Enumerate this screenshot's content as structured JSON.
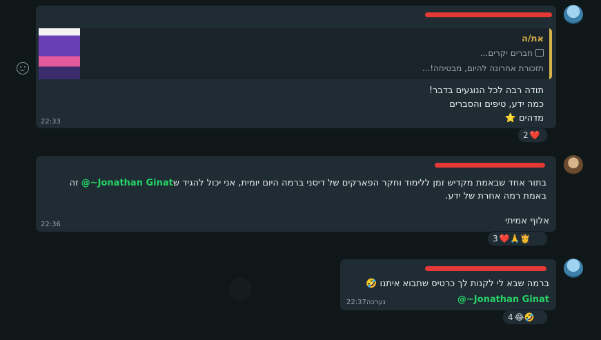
{
  "messages": [
    {
      "quote": {
        "author": "את/ה",
        "line1": "חברים יקרים...",
        "line2": "תזכורת אחרונה להיום, מבטיחה!..."
      },
      "text_lines": [
        "תודה רבה לכל הנוגעים בדבר!",
        "כמה ידע, טיפים והסברים",
        "מדהים ⭐"
      ],
      "time": "22:33",
      "reactions": {
        "emojis": "❤️",
        "count": "2"
      }
    },
    {
      "text_lines": [
        "בתור אחד שבאמת מקדיש זמן ללימוד וחקר הפארקים של דיסני ברמה היום יומית, אני יכול להגיד ש",
        "@~Jonathan Ginat",
        " זה",
        "באמת רמה אחרת של ידע.",
        "אלוף אמיתי"
      ],
      "time": "22:36",
      "reactions": {
        "emojis": "❤️🙏👸",
        "count": "3"
      }
    },
    {
      "text_lines": [
        "ברמה שבא לי לקנות לך כרטיס שתבוא איתנו 🤣",
        "@~Jonathan Ginat"
      ],
      "time": "22:37",
      "edited": "נערכה",
      "reactions": {
        "emojis": "😂🤣",
        "count": "4"
      }
    }
  ],
  "colors": {
    "accent_quote": "#d7b24a",
    "mention": "#25d366",
    "redaction": "#e53935"
  },
  "icons": [
    "emoji-icon",
    "image-icon"
  ]
}
